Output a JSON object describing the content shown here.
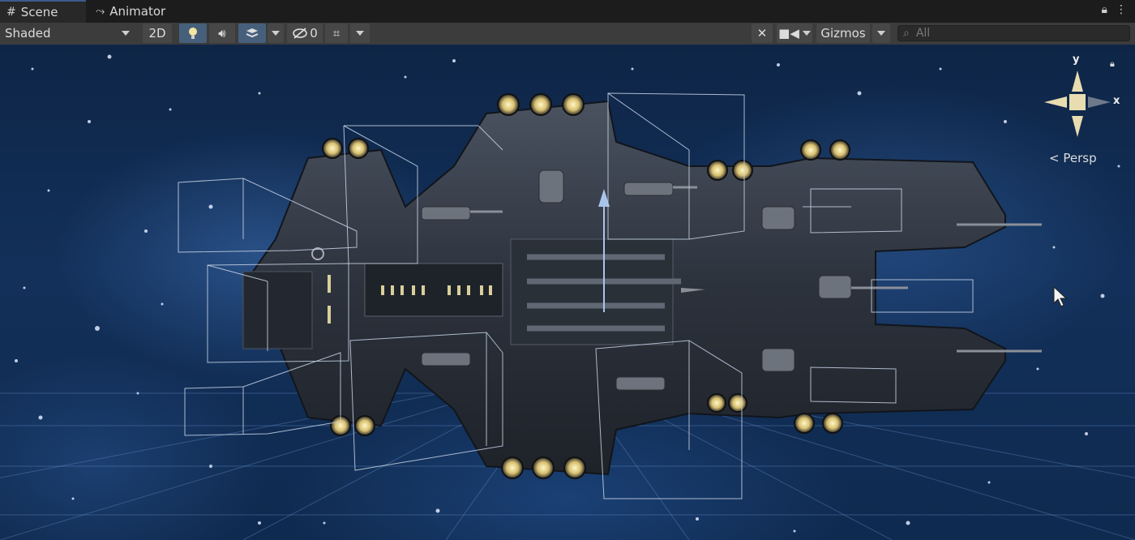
{
  "tabs": [
    {
      "label": "Scene",
      "icon": "grid-icon",
      "active": true
    },
    {
      "label": "Animator",
      "icon": "animator-icon",
      "active": false
    }
  ],
  "toolbar": {
    "shading_mode": "Shaded",
    "mode_2d": "2D",
    "hidden_count": "0",
    "gizmos_label": "Gizmos",
    "search_placeholder": "All"
  },
  "gizmo": {
    "x_label": "x",
    "y_label": "y",
    "projection_label": "Persp"
  },
  "colors": {
    "accent": "#46607c",
    "toolbar": "#3c3c3c",
    "space": "#12305a",
    "gizmo": "#e8dcb0"
  }
}
